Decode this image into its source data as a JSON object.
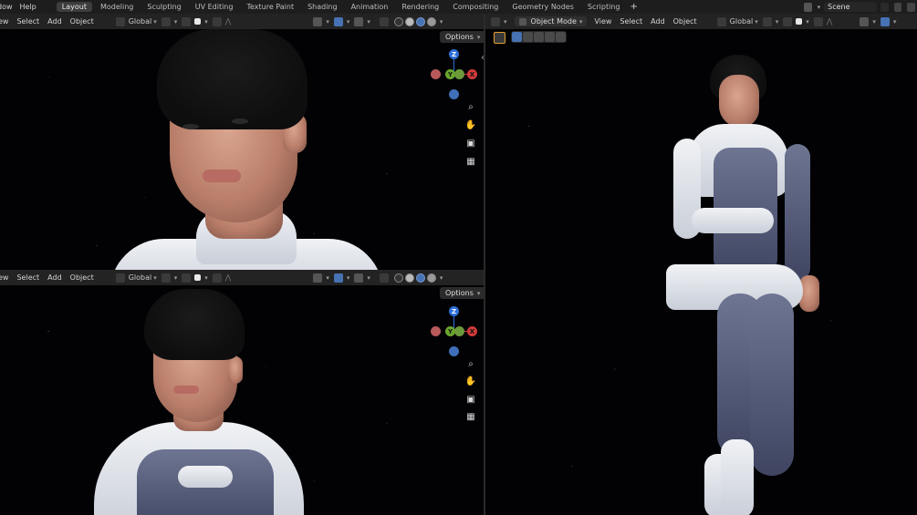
{
  "topbar": {
    "menu": [
      "dow",
      "Help"
    ],
    "workspaces": [
      {
        "label": "Layout",
        "active": true
      },
      {
        "label": "Modeling",
        "active": false
      },
      {
        "label": "Sculpting",
        "active": false
      },
      {
        "label": "UV Editing",
        "active": false
      },
      {
        "label": "Texture Paint",
        "active": false
      },
      {
        "label": "Shading",
        "active": false
      },
      {
        "label": "Animation",
        "active": false
      },
      {
        "label": "Rendering",
        "active": false
      },
      {
        "label": "Compositing",
        "active": false
      },
      {
        "label": "Geometry Nodes",
        "active": false
      },
      {
        "label": "Scripting",
        "active": false
      }
    ],
    "add_workspace": "+",
    "scene_name": "Scene"
  },
  "viewport_top_left": {
    "header": {
      "view": "ew",
      "select": "Select",
      "add": "Add",
      "object": "Object",
      "orientation": "Global"
    },
    "options_label": "Options"
  },
  "viewport_bottom_left": {
    "header": {
      "view": "ew",
      "select": "Select",
      "add": "Add",
      "object": "Object",
      "orientation": "Global"
    },
    "options_label": "Options"
  },
  "viewport_right": {
    "header": {
      "mode": "Object Mode",
      "view": "View",
      "select": "Select",
      "add": "Add",
      "object": "Object",
      "orientation": "Global"
    }
  },
  "gizmo": {
    "z": "Z",
    "y": "Y",
    "x": "X"
  },
  "colors": {
    "active_blue": "#4772b3",
    "x_axis": "#d23a3a",
    "y_axis": "#6aa62d",
    "z_axis": "#2d6fd8"
  }
}
